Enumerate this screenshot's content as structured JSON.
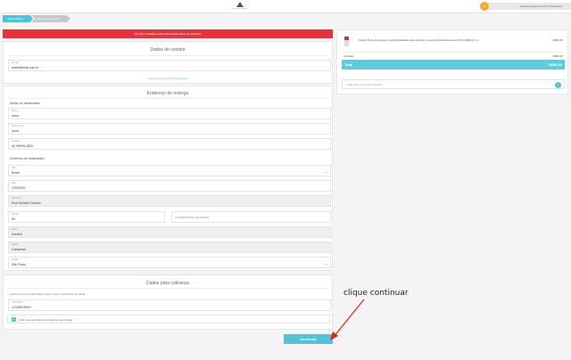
{
  "header": {
    "logo_text": "Natura Consultoria",
    "user_name": "Vanilpra Nogueira (VNX Prestação)"
  },
  "steps": [
    {
      "label": "Meus Dados"
    },
    {
      "label": "Frete e Pagamento"
    }
  ],
  "alert": {
    "text": "Por favor, verifique suas informações antes de continuar"
  },
  "contact": {
    "title": "Dados de contato",
    "email_label": "E-mail",
    "email_value": "teste@teste.com.br",
    "hint_prefix": "Você tem uma conta?",
    "hint_link": "Iniciar sessão"
  },
  "delivery": {
    "title": "Endereço de entrega",
    "recipient_heading": "Dados do destinatário",
    "name_label": "Nome",
    "name_value": "nana",
    "surname_label": "Sobrenome",
    "surname_value": "nana",
    "phone_label": "Telefone",
    "phone_value": "(4) 99999-2800",
    "address_heading": "Endereço do destinatário",
    "country_label": "País",
    "country_value": "Brasil",
    "cep_label": "CEP",
    "cep_value": "13020020",
    "street_label": "Endereço",
    "street_value": "Rua Setúbal Dumont",
    "number_label": "Número",
    "number_value": "80",
    "complement_placeholder": "Complemento (opcional)",
    "district_label": "Bairro",
    "district_value": "Cambuí",
    "city_label": "Cidade",
    "city_value": "Campinas",
    "state_label": "Estado",
    "state_value": "São Paulo"
  },
  "billing": {
    "title": "Dados para cobrança",
    "note": "Usaremos essas informações para emitir a nota fiscal da venda.",
    "cpf_label": "CPF/CNPJ",
    "cpf_value": "12345678909",
    "same_address_label": "Usar mesmos dados do endereço de entrega",
    "same_address_checked": true
  },
  "actions": {
    "continue_label": "Continuar"
  },
  "annotation": {
    "text": "clique continuar",
    "color": "#e0201c"
  },
  "summary": {
    "product_name": "Natura Todo dia Cereja e Avelã Hidratante Desodorante Corporal Pele Extrasseca 400 ml R$13,0 x 1",
    "product_price": "R$36,50",
    "subtotal_label": "Subtotal",
    "subtotal_value": "R$36,50",
    "total_label": "Total",
    "total_value": "R$36,50",
    "coupon_placeholder": "Código de cupom de desconto",
    "coupon_button": "›"
  },
  "colors": {
    "accent": "#52c3d5",
    "alert": "#e2343a"
  }
}
